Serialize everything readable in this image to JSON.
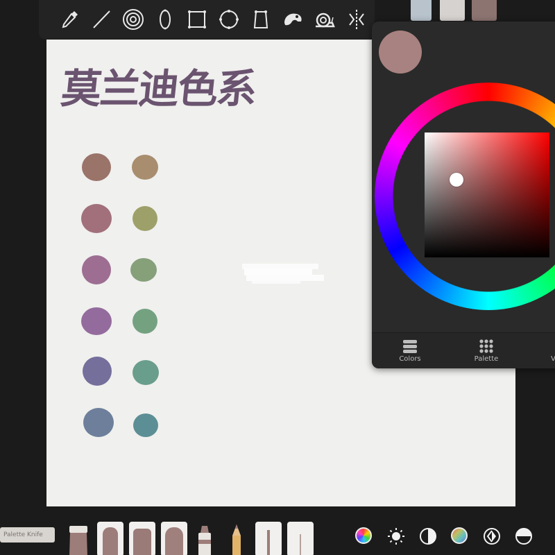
{
  "window": {
    "title": ""
  },
  "canvas": {
    "title_text": "莫兰迪色系",
    "title_color": "#6b5470",
    "swatches_left": [
      "#9a7369",
      "#a1707b",
      "#9d6e92",
      "#946b9d",
      "#756f9c",
      "#6d7f9b"
    ],
    "swatches_right": [
      "#a88d6f",
      "#9ea06a",
      "#86a07a",
      "#74a281",
      "#6a9e8c",
      "#5c8f95"
    ]
  },
  "top_toolbar": {
    "tools": [
      "eyedropper-icon",
      "line-icon",
      "concentric-circles-icon",
      "ellipse-icon",
      "rectangle-icon",
      "circle-icon",
      "perspective-rect-icon",
      "chameleon-icon",
      "snail-icon",
      "symmetry-icon"
    ]
  },
  "top_swatches": [
    "#b8c3cc",
    "#d6d2d0",
    "#8c7471"
  ],
  "color_panel": {
    "current_color": "#a88280",
    "tabs": [
      {
        "label": "Colors"
      },
      {
        "label": "Palette"
      },
      {
        "label": "V"
      }
    ]
  },
  "bottom_bar": {
    "active_tool_label": "Palette Knife",
    "brush_tip_color": "#9d7d79",
    "adjustments": [
      "color-wheel-icon",
      "brightness-icon",
      "contrast-icon",
      "hue-icon",
      "invert-icon",
      "half-circle-icon"
    ]
  }
}
